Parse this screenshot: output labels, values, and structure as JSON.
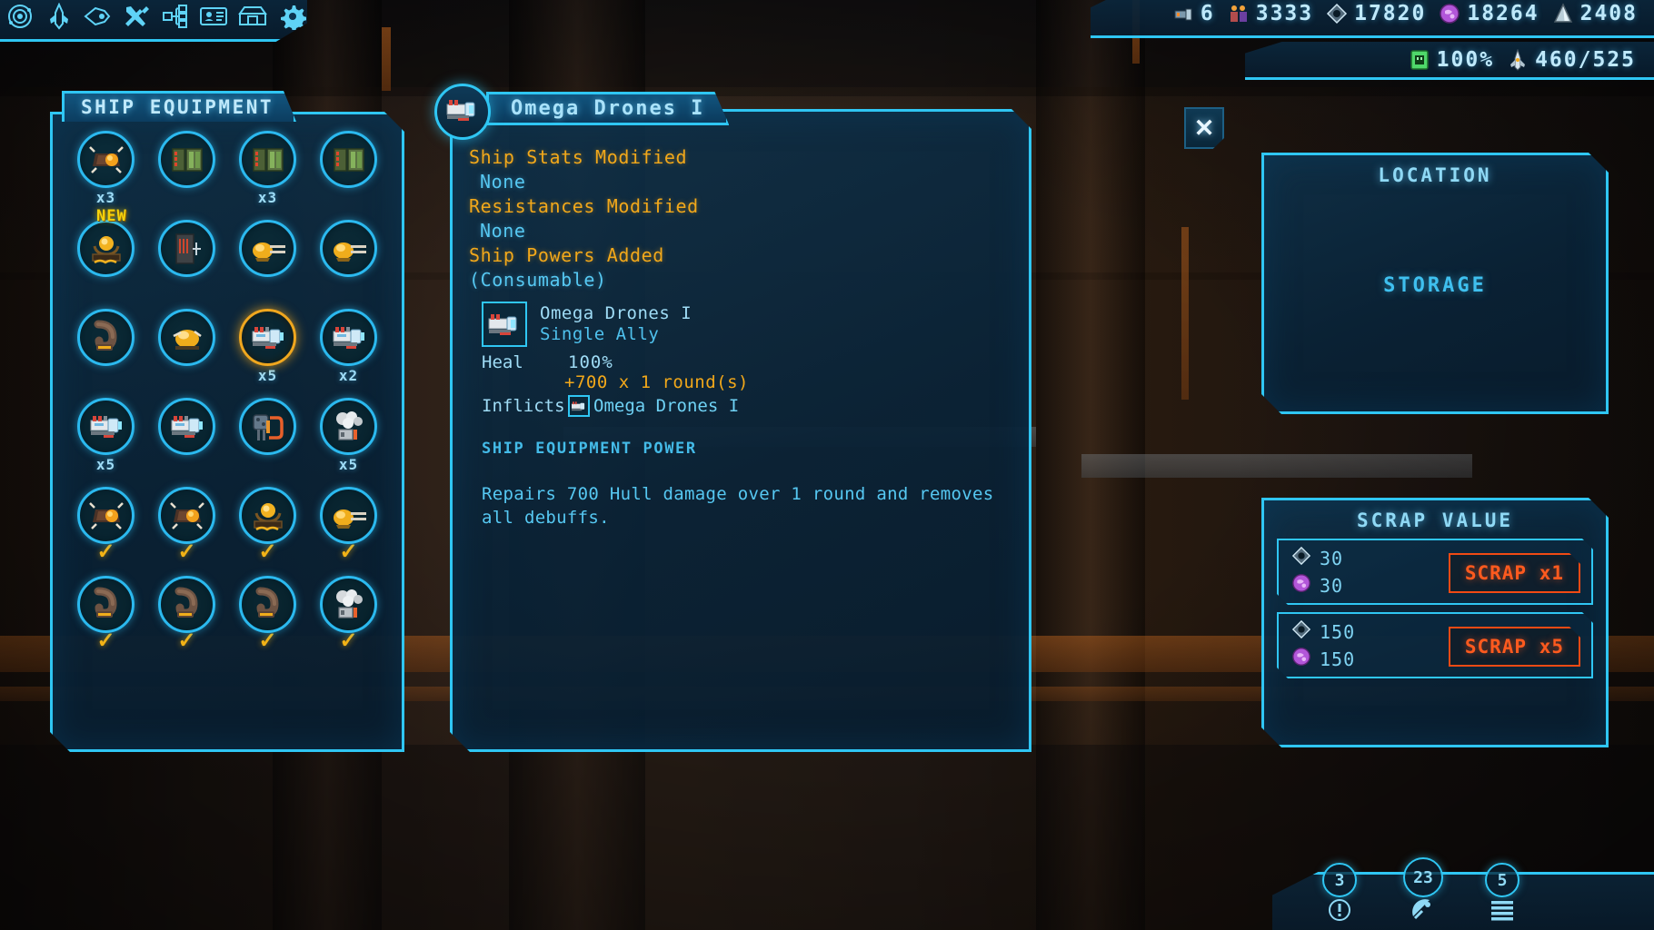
{
  "toolbar": {
    "items": [
      {
        "name": "galaxy-map-icon",
        "label": "Galaxy Map"
      },
      {
        "name": "ship-icon",
        "label": "Ship"
      },
      {
        "name": "shuttle-icon",
        "label": "Shuttle"
      },
      {
        "name": "tools-icon",
        "label": "Workshop"
      },
      {
        "name": "tech-tree-icon",
        "label": "Tech Tree"
      },
      {
        "name": "crew-id-icon",
        "label": "Crew"
      },
      {
        "name": "cargo-chest-icon",
        "label": "Cargo"
      },
      {
        "name": "gear-icon",
        "label": "Settings"
      }
    ]
  },
  "resources": [
    {
      "icon": "fuel-icon",
      "value": "6"
    },
    {
      "icon": "crew-icon",
      "value": "3333"
    },
    {
      "icon": "ore-icon",
      "value": "17820"
    },
    {
      "icon": "biomass-icon",
      "value": "18264"
    },
    {
      "icon": "crystal-icon",
      "value": "2408"
    }
  ],
  "status": [
    {
      "icon": "shield-cell-icon",
      "value": "100%"
    },
    {
      "icon": "hull-ship-icon",
      "value": "460/525"
    }
  ],
  "equipment_panel": {
    "title": "SHIP EQUIPMENT",
    "slots": [
      {
        "icon": "mine-orange-icon",
        "qty": "x3",
        "check": "",
        "new": false,
        "selected": false
      },
      {
        "icon": "green-module-icon",
        "qty": "",
        "check": "",
        "new": false,
        "selected": false
      },
      {
        "icon": "green-module-icon",
        "qty": "x3",
        "check": "",
        "new": false,
        "selected": false
      },
      {
        "icon": "green-module-icon",
        "qty": "",
        "check": "",
        "new": false,
        "selected": false
      },
      {
        "icon": "gold-orb-rack-icon",
        "qty": "",
        "check": "",
        "new": true,
        "newlabel": "NEW",
        "selected": false
      },
      {
        "icon": "dark-panel-icon",
        "qty": "",
        "check": "",
        "new": false,
        "selected": false
      },
      {
        "icon": "gold-cannon-icon",
        "qty": "",
        "check": "",
        "new": false,
        "selected": false
      },
      {
        "icon": "gold-cannon-icon",
        "qty": "",
        "check": "",
        "new": false,
        "selected": false
      },
      {
        "icon": "brown-hook-icon",
        "qty": "",
        "check": "",
        "new": false,
        "selected": false
      },
      {
        "icon": "gold-pod-icon",
        "qty": "",
        "check": "",
        "new": false,
        "selected": false
      },
      {
        "icon": "omega-drone-icon",
        "qty": "x5",
        "check": "",
        "new": false,
        "selected": true
      },
      {
        "icon": "omega-drone-icon",
        "qty": "x2",
        "check": "",
        "new": false,
        "selected": false
      },
      {
        "icon": "omega-drone-icon",
        "qty": "x5",
        "check": "",
        "new": false,
        "selected": false
      },
      {
        "icon": "omega-drone-icon",
        "qty": "",
        "check": "",
        "new": false,
        "selected": false
      },
      {
        "icon": "generator-hose-icon",
        "qty": "",
        "check": "",
        "new": false,
        "selected": false
      },
      {
        "icon": "smoke-vent-icon",
        "qty": "x5",
        "check": "",
        "new": false,
        "selected": false
      },
      {
        "icon": "mine-orange-icon",
        "qty": "",
        "check": "✓",
        "new": false,
        "selected": false
      },
      {
        "icon": "mine-orange-icon",
        "qty": "",
        "check": "✓",
        "new": false,
        "selected": false
      },
      {
        "icon": "gold-orb-rack-icon",
        "qty": "",
        "check": "✓",
        "new": false,
        "selected": false
      },
      {
        "icon": "gold-cannon-icon",
        "qty": "",
        "check": "✓",
        "new": false,
        "selected": false
      },
      {
        "icon": "brown-hook-icon",
        "qty": "",
        "check": "✓",
        "new": false,
        "selected": false
      },
      {
        "icon": "brown-hook-icon",
        "qty": "",
        "check": "✓",
        "new": false,
        "selected": false
      },
      {
        "icon": "brown-hook-icon",
        "qty": "",
        "check": "✓",
        "new": false,
        "selected": false
      },
      {
        "icon": "smoke-vent-icon",
        "qty": "",
        "check": "✓",
        "new": false,
        "selected": false
      }
    ]
  },
  "detail": {
    "title": "Omega Drones I",
    "close_label": "✕",
    "stats_heading": "Ship Stats Modified",
    "stats_value": "None",
    "resist_heading": "Resistances Modified",
    "resist_value": "None",
    "powers_heading": "Ship Powers Added",
    "powers_subheading": "(Consumable)",
    "power_name": "Omega Drones I",
    "power_target": "Single Ally",
    "heal_label": "Heal",
    "heal_value": "100%",
    "heal_detail": "+700 x 1 round(s)",
    "inflicts_label": "Inflicts",
    "inflicts_value": "Omega Drones I",
    "section_label": "SHIP EQUIPMENT POWER",
    "description": "Repairs 700 Hull damage over 1 round and removes all debuffs."
  },
  "location": {
    "heading": "LOCATION",
    "value": "STORAGE"
  },
  "scrap": {
    "heading": "SCRAP VALUE",
    "rows": [
      {
        "ore": "30",
        "biomass": "30",
        "button": "SCRAP x1"
      },
      {
        "ore": "150",
        "biomass": "150",
        "button": "SCRAP x5"
      }
    ]
  },
  "bottom_nav": [
    {
      "count": "3",
      "icon": "alert-icon"
    },
    {
      "count": "23",
      "icon": "radar-dish-icon"
    },
    {
      "count": "5",
      "icon": "menu-lines-icon"
    }
  ],
  "colors": {
    "accent": "#2fc6f3",
    "gold": "#f2a81a",
    "scrap_red": "#ff5a1e",
    "selected_ring": "#f0a71e"
  }
}
